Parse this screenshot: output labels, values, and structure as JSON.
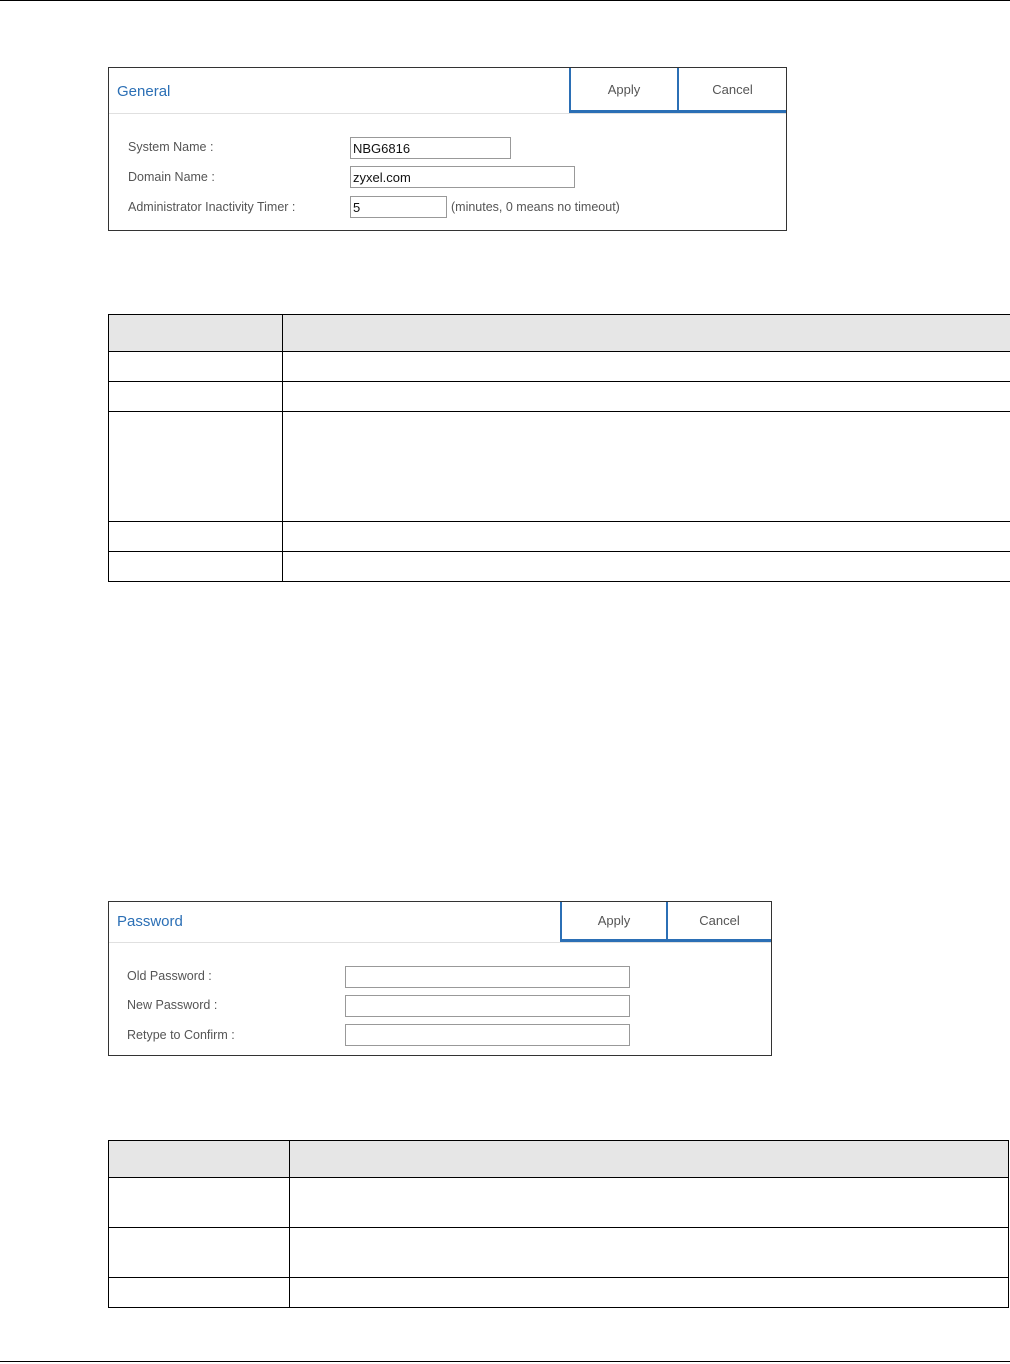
{
  "general_panel": {
    "title": "General",
    "apply_label": "Apply",
    "cancel_label": "Cancel",
    "fields": [
      {
        "label": "System Name :",
        "value": "NBG6816"
      },
      {
        "label": "Domain Name :",
        "value": "zyxel.com"
      },
      {
        "label": "Administrator Inactivity Timer :",
        "value": "5",
        "note": "(minutes, 0 means no timeout)"
      }
    ]
  },
  "password_panel": {
    "title": "Password",
    "apply_label": "Apply",
    "cancel_label": "Cancel",
    "fields": [
      {
        "label": "Old Password :",
        "value": ""
      },
      {
        "label": "New Password :",
        "value": ""
      },
      {
        "label": "Retype to Confirm :",
        "value": ""
      }
    ]
  }
}
